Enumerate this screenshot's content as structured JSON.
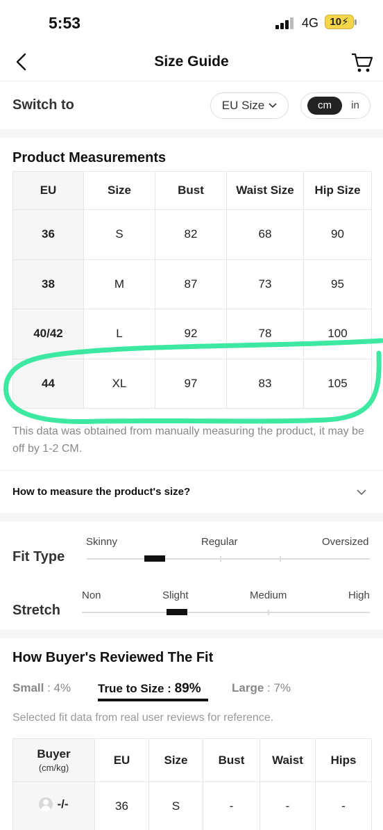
{
  "status_bar": {
    "time": "5:53",
    "network": "4G",
    "battery": "10"
  },
  "header": {
    "title": "Size Guide"
  },
  "switch": {
    "label": "Switch to",
    "size_system": "EU Size",
    "units": [
      "cm",
      "in"
    ],
    "selected_unit": "cm"
  },
  "measurements": {
    "title": "Product Measurements",
    "columns": [
      "EU",
      "Size",
      "Bust",
      "Waist Size",
      "Hip Size"
    ],
    "rows": [
      [
        "36",
        "S",
        "82",
        "68",
        "90"
      ],
      [
        "38",
        "M",
        "87",
        "73",
        "95"
      ],
      [
        "40/42",
        "L",
        "92",
        "78",
        "100"
      ],
      [
        "44",
        "XL",
        "97",
        "83",
        "105"
      ]
    ],
    "note": "This data was obtained from manually measuring the product, it may be off by 1-2 CM.",
    "how_to": "How to measure the product's size?"
  },
  "fit_type": {
    "label": "Fit Type",
    "scale": [
      "Skinny",
      "Regular",
      "Oversized"
    ],
    "level": 0.24
  },
  "stretch": {
    "label": "Stretch",
    "scale": [
      "Non",
      "Slight",
      "Medium",
      "High"
    ],
    "level": 0.33
  },
  "reviews": {
    "title": "How Buyer's Reviewed The Fit",
    "small": {
      "label": "Small",
      "value": "4%"
    },
    "true_to_size": {
      "label": "True to Size",
      "value": "89%"
    },
    "large": {
      "label": "Large",
      "value": "7%"
    },
    "note": "Selected fit data from real user reviews for reference.",
    "columns": {
      "buyer": "Buyer",
      "buyer_sub": "(cm/kg)",
      "eu": "EU",
      "size": "Size",
      "bust": "Bust",
      "waist": "Waist",
      "hips": "Hips"
    },
    "rows": [
      {
        "buyer": "-/-",
        "eu": "36",
        "size": "S",
        "bust": "-",
        "waist": "-",
        "hips": "-"
      }
    ]
  },
  "colors": {
    "highlight": "#3de8a0",
    "accent": "#111111"
  }
}
